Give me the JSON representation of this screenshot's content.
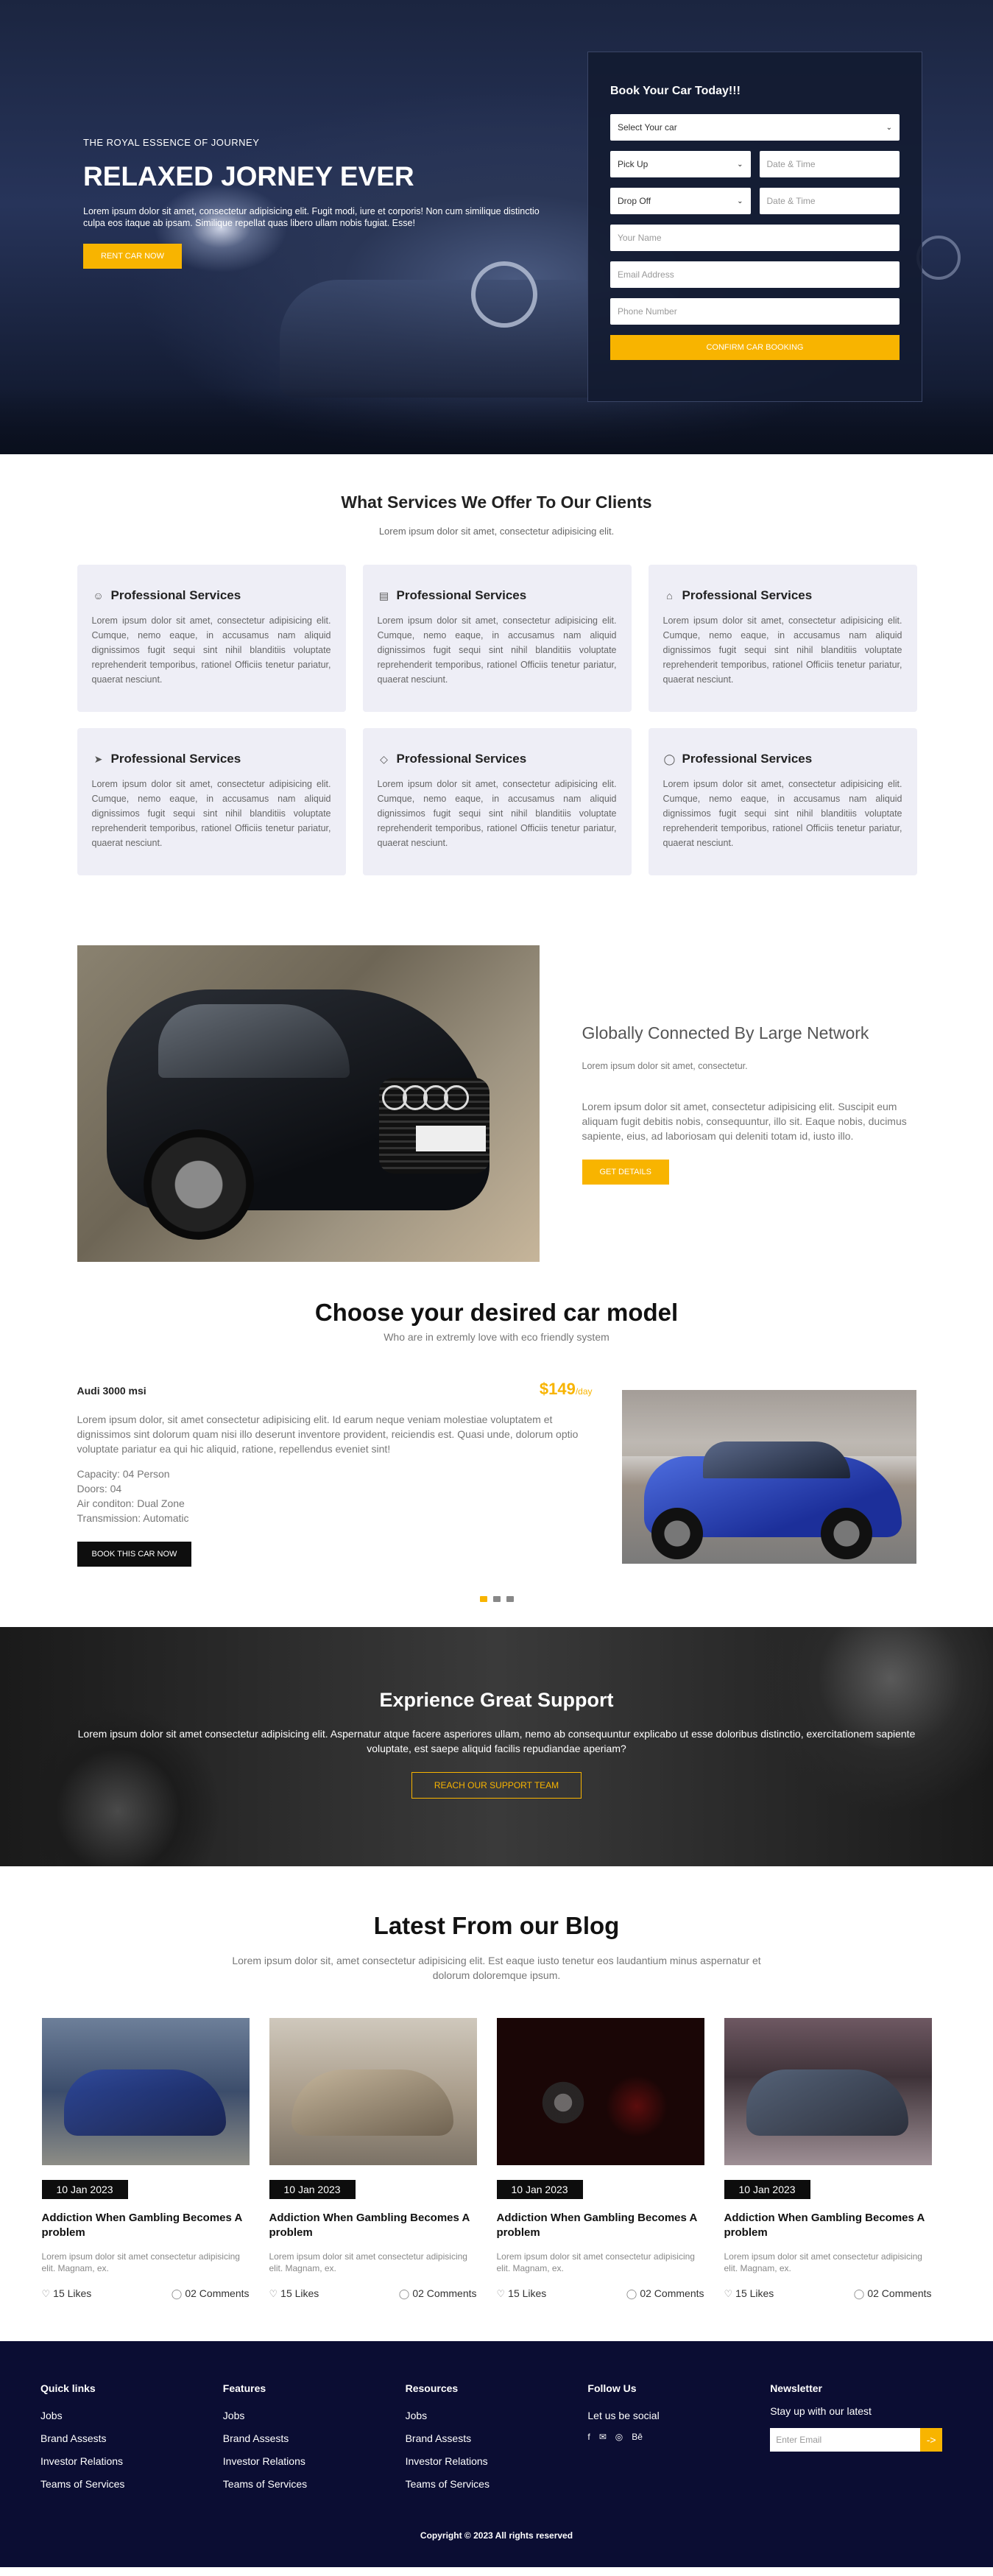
{
  "hero": {
    "kicker": "THE ROYAL ESSENCE OF JOURNEY",
    "title": "RELAXED JORNEY EVER",
    "description": "Lorem ipsum dolor sit amet, consectetur adipisicing elit. Fugit modi, iure et corporis! Non cum similique distinctio culpa eos itaque ab ipsam. Similique repellat quas libero ullam nobis fugiat. Esse!",
    "cta_label": "RENT CAR NOW"
  },
  "booking": {
    "title": "Book Your Car Today!!!",
    "car_select": "Select Your car",
    "pickup_select": "Pick Up",
    "pickup_datetime_placeholder": "Date & Time",
    "dropoff_select": "Drop Off",
    "dropoff_datetime_placeholder": "Date & Time",
    "name_placeholder": "Your Name",
    "email_placeholder": "Email Address",
    "phone_placeholder": "Phone Number",
    "submit_label": "CONFIRM CAR BOOKING"
  },
  "services": {
    "title": "What Services We Offer To Our Clients",
    "subtitle": "Lorem ipsum dolor sit amet, consectetur adipisicing elit.",
    "items": [
      {
        "icon": "user-icon",
        "title": "Professional Services",
        "desc": "Lorem ipsum dolor sit amet, consectetur adipisicing elit. Cumque, nemo eaque, in accusamus nam aliquid dignissimos fugit sequi sint nihil blanditiis voluptate reprehenderit temporibus, rationel Officiis tenetur pariatur, quaerat nesciunt."
      },
      {
        "icon": "id-card-icon",
        "title": "Professional Services",
        "desc": "Lorem ipsum dolor sit amet, consectetur adipisicing elit. Cumque, nemo eaque, in accusamus nam aliquid dignissimos fugit sequi sint nihil blanditiis voluptate reprehenderit temporibus, rationel Officiis tenetur pariatur, quaerat nesciunt."
      },
      {
        "icon": "building-icon",
        "title": "Professional Services",
        "desc": "Lorem ipsum dolor sit amet, consectetur adipisicing elit. Cumque, nemo eaque, in accusamus nam aliquid dignissimos fugit sequi sint nihil blanditiis voluptate reprehenderit temporibus, rationel Officiis tenetur pariatur, quaerat nesciunt."
      },
      {
        "icon": "rocket-icon",
        "title": "Professional Services",
        "desc": "Lorem ipsum dolor sit amet, consectetur adipisicing elit. Cumque, nemo eaque, in accusamus nam aliquid dignissimos fugit sequi sint nihil blanditiis voluptate reprehenderit temporibus, rationel Officiis tenetur pariatur, quaerat nesciunt."
      },
      {
        "icon": "diamond-icon",
        "title": "Professional Services",
        "desc": "Lorem ipsum dolor sit amet, consectetur adipisicing elit. Cumque, nemo eaque, in accusamus nam aliquid dignissimos fugit sequi sint nihil blanditiis voluptate reprehenderit temporibus, rationel Officiis tenetur pariatur, quaerat nesciunt."
      },
      {
        "icon": "chat-icon",
        "title": "Professional Services",
        "desc": "Lorem ipsum dolor sit amet, consectetur adipisicing elit. Cumque, nemo eaque, in accusamus nam aliquid dignissimos fugit sequi sint nihil blanditiis voluptate reprehenderit temporibus, rationel Officiis tenetur pariatur, quaerat nesciunt."
      }
    ]
  },
  "network": {
    "title": "Globally Connected By Large Network",
    "subtitle": "Lorem ipsum dolor sit amet, consectetur.",
    "description": "Lorem ipsum dolor sit amet, consectetur adipisicing elit. Suscipit eum aliquam fugit debitis nobis, consequuntur, illo sit. Eaque nobis, ducimus sapiente, eius, ad laboriosam qui deleniti totam id, iusto illo.",
    "cta_label": "GET DETAILS"
  },
  "models": {
    "title": "Choose your desired car model",
    "subtitle": "Who are in extremly love with eco friendly system",
    "current": {
      "name": "Audi 3000 msi",
      "price": "$149",
      "price_unit": "/day",
      "description": "Lorem ipsum dolor, sit amet consectetur adipisicing elit. Id earum neque veniam molestiae voluptatem et dignissimos sint dolorum quam nisi illo deserunt inventore provident, reiciendis est. Quasi unde, dolorum optio voluptate pariatur ea qui hic aliquid, ratione, repellendus eveniet sint!",
      "capacity": "Capacity: 04 Person",
      "doors": "Doors: 04",
      "air": "Air conditon: Dual Zone",
      "transmission": "Transmission: Automatic",
      "cta_label": "BOOK THIS CAR NOW"
    },
    "slides_count": 3,
    "active_slide": 1
  },
  "support": {
    "title": "Exprience Great Support",
    "description": "Lorem ipsum dolor sit amet consectetur adipisicing elit. Aspernatur atque facere asperiores ullam, nemo ab consequuntur explicabo ut esse doloribus distinctio, exercitationem sapiente voluptate, est saepe aliquid facilis repudiandae aperiam?",
    "cta_label": "REACH OUR SUPPORT TEAM"
  },
  "blog": {
    "title": "Latest From our Blog",
    "subtitle": "Lorem ipsum dolor sit, amet consectetur adipisicing elit. Est eaque iusto tenetur eos laudantium minus aspernatur et dolorum doloremque ipsum.",
    "posts": [
      {
        "date": "10 Jan 2023",
        "title": "Addiction When Gambling Becomes A problem",
        "desc": "Lorem ipsum dolor sit amet consectetur adipisicing elit. Magnam, ex.",
        "likes": "15 Likes",
        "comments": "02 Comments"
      },
      {
        "date": "10 Jan 2023",
        "title": "Addiction When Gambling Becomes A problem",
        "desc": "Lorem ipsum dolor sit amet consectetur adipisicing elit. Magnam, ex.",
        "likes": "15 Likes",
        "comments": "02 Comments"
      },
      {
        "date": "10 Jan 2023",
        "title": "Addiction When Gambling Becomes A problem",
        "desc": "Lorem ipsum dolor sit amet consectetur adipisicing elit. Magnam, ex.",
        "likes": "15 Likes",
        "comments": "02 Comments"
      },
      {
        "date": "10 Jan 2023",
        "title": "Addiction When Gambling Becomes A problem",
        "desc": "Lorem ipsum dolor sit amet consectetur adipisicing elit. Magnam, ex.",
        "likes": "15 Likes",
        "comments": "02 Comments"
      }
    ]
  },
  "footer": {
    "quick_links": {
      "title": "Quick links",
      "items": [
        "Jobs",
        "Brand Assests",
        "Investor Relations",
        "Teams of Services"
      ]
    },
    "features": {
      "title": "Features",
      "items": [
        "Jobs",
        "Brand Assests",
        "Investor Relations",
        "Teams of Services"
      ]
    },
    "resources": {
      "title": "Resources",
      "items": [
        "Jobs",
        "Brand Assests",
        "Investor Relations",
        "Teams of Services"
      ]
    },
    "follow": {
      "title": "Follow Us",
      "text": "Let us be social",
      "icons": [
        "facebook-icon",
        "twitter-icon",
        "dribbble-icon",
        "behance-icon"
      ]
    },
    "newsletter": {
      "title": "Newsletter",
      "text": "Stay up with our latest",
      "placeholder": "Enter Email",
      "go_label": "->"
    },
    "copyright": "Copyright © 2023 All rights reserved"
  },
  "colors": {
    "accent": "#f8b400",
    "footer_bg": "#0b0d33",
    "card_bg": "#eeeef6"
  }
}
